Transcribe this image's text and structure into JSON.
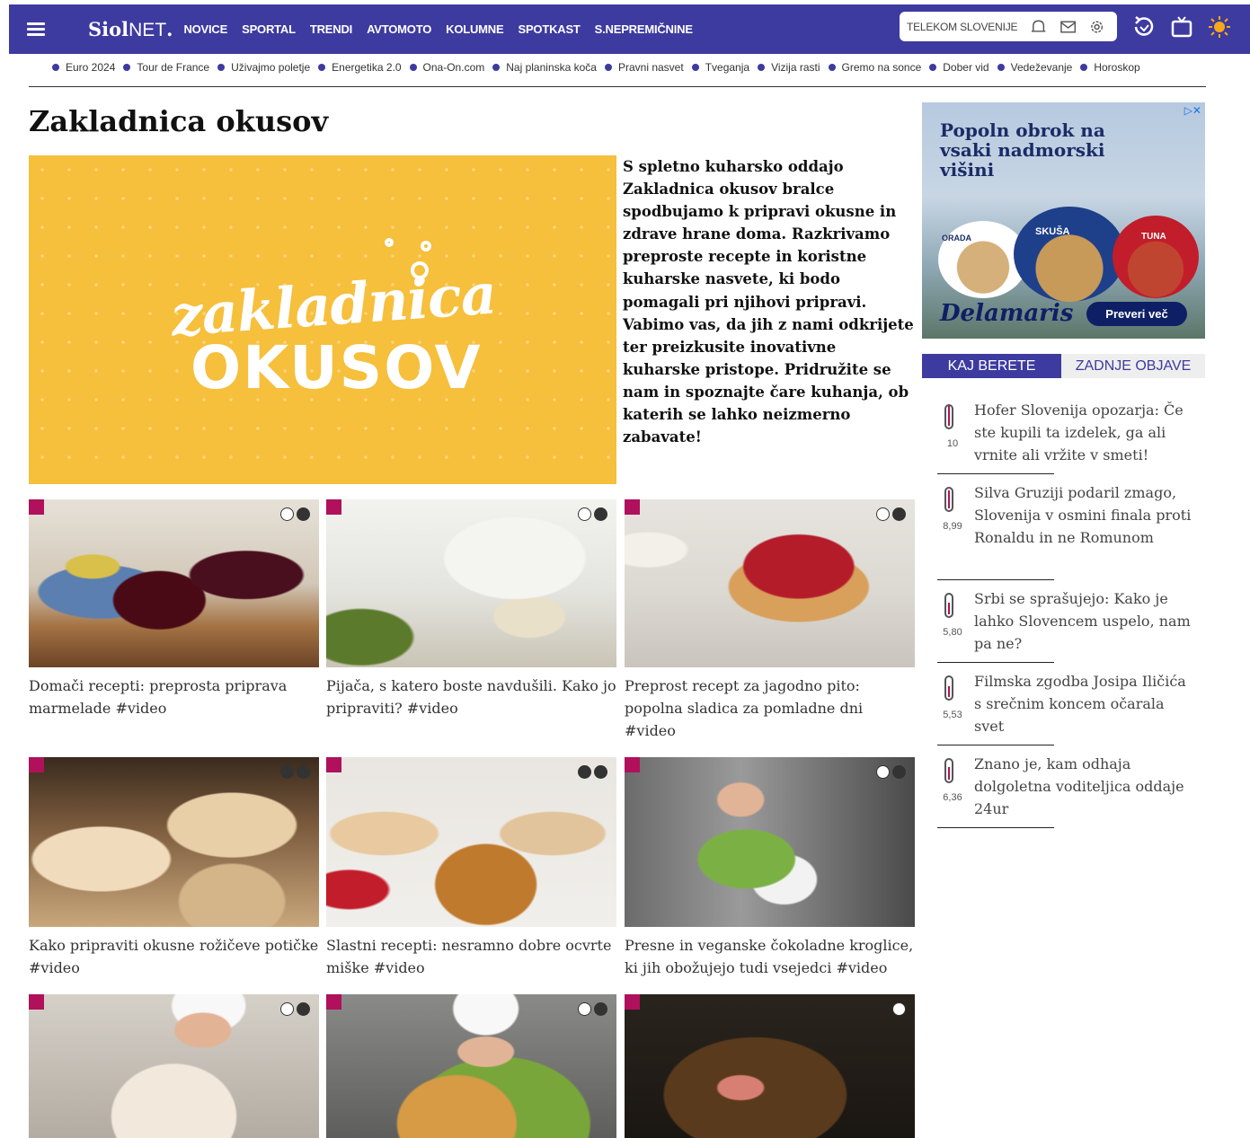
{
  "header": {
    "logo_main": "Siol",
    "logo_suffix": "NET",
    "logo_dot": ".",
    "nav": [
      "NOVICE",
      "SPORTAL",
      "TRENDI",
      "AVTOMOTO",
      "KOLUMNE",
      "SPOTKAST",
      "S.NEPREMIČNINE"
    ],
    "telekom_label": "TELEKOM SLOVENIJE"
  },
  "trending": [
    "Euro 2024",
    "Tour de France",
    "Uživajmo poletje",
    "Energetika 2.0",
    "Ona-On.com",
    "Naj planinska koča",
    "Pravni nasvet",
    "Tveganja",
    "Vizija rasti",
    "Gremo na sonce",
    "Dober vid",
    "Vedeževanje",
    "Horoskop"
  ],
  "page": {
    "title": "Zakladnica okusov",
    "hero_line1": "zakladnica",
    "hero_line2": "OKUSOV",
    "intro": "S spletno kuharsko oddajo Zakladnica okusov bralce spodbujamo k pripravi okusne in zdrave hrane doma. Razkrivamo preproste recepte in koristne kuharske nasvete, ki bodo pomagali pri njihovi pripravi. Vabimo vas, da jih z nami odkrijete ter preizkusite inovativne kuharske pristope. Pridružite se nam in spoznajte čare kuhanja, ob katerih se lahko neizmerno zabavate!"
  },
  "articles": [
    {
      "caption": "Domači recepti: preprosta priprava marmelade #video"
    },
    {
      "caption": "Pijača, s katero boste navdušili. Kako jo pripraviti? #video"
    },
    {
      "caption": "Preprost recept za jagodno pito: popolna sladica za pomladne dni #video"
    },
    {
      "caption": "Kako pripraviti okusne rožičeve potičke #video"
    },
    {
      "caption": "Slastni recepti: nesramno dobre ocvrte miške #video"
    },
    {
      "caption": "Presne in veganske čokoladne kroglice, ki jih obožujejo tudi vsejedci #video"
    },
    {
      "caption": ""
    },
    {
      "caption": ""
    },
    {
      "caption": ""
    }
  ],
  "ad": {
    "title": "Popoln obrok na vsaki nadmorski višini",
    "brand": "Delamaris",
    "cta": "Preveri več",
    "labels": [
      "ORADA",
      "SKUŠA",
      "TUNA"
    ]
  },
  "sidebar": {
    "tab_active": "KAJ BERETE",
    "tab_inactive": "ZADNJE OBJAVE",
    "items": [
      {
        "score": "10",
        "level": 1.0,
        "text": "Hofer Slovenija opozarja: Če ste kupili ta izdelek, ga ali vrnite ali vržite v smeti!"
      },
      {
        "score": "8,99",
        "level": 0.9,
        "text": "Silva Gruziji podaril zmago, Slovenija v osmini finala proti Ronaldu in ne Romunom"
      },
      {
        "score": "5,80",
        "level": 0.58,
        "text": "Srbi se sprašujejo: Kako je lahko Slovencem uspelo, nam pa ne?"
      },
      {
        "score": "5,53",
        "level": 0.55,
        "text": "Filmska zgodba Josipa Iličića s srečnim koncem očarala svet"
      },
      {
        "score": "6,36",
        "level": 0.64,
        "text": "Znano je, kam odhaja dolgoletna voditeljica oddaje 24ur"
      }
    ]
  },
  "colors": {
    "brand": "#3d3aa0",
    "accent": "#b0105c",
    "hero_bg": "#f6bf3c"
  }
}
